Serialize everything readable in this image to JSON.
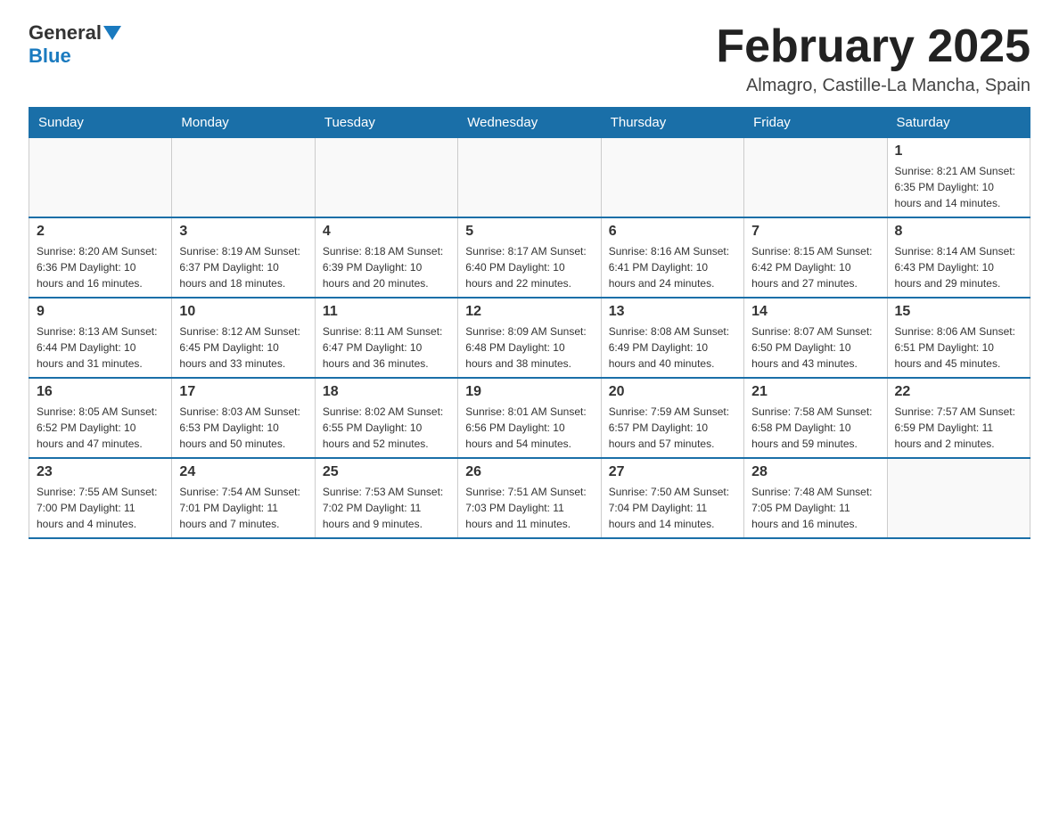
{
  "header": {
    "logo_general": "General",
    "logo_blue": "Blue",
    "title": "February 2025",
    "subtitle": "Almagro, Castille-La Mancha, Spain"
  },
  "weekdays": [
    "Sunday",
    "Monday",
    "Tuesday",
    "Wednesday",
    "Thursday",
    "Friday",
    "Saturday"
  ],
  "weeks": [
    [
      {
        "day": "",
        "info": ""
      },
      {
        "day": "",
        "info": ""
      },
      {
        "day": "",
        "info": ""
      },
      {
        "day": "",
        "info": ""
      },
      {
        "day": "",
        "info": ""
      },
      {
        "day": "",
        "info": ""
      },
      {
        "day": "1",
        "info": "Sunrise: 8:21 AM\nSunset: 6:35 PM\nDaylight: 10 hours and 14 minutes."
      }
    ],
    [
      {
        "day": "2",
        "info": "Sunrise: 8:20 AM\nSunset: 6:36 PM\nDaylight: 10 hours and 16 minutes."
      },
      {
        "day": "3",
        "info": "Sunrise: 8:19 AM\nSunset: 6:37 PM\nDaylight: 10 hours and 18 minutes."
      },
      {
        "day": "4",
        "info": "Sunrise: 8:18 AM\nSunset: 6:39 PM\nDaylight: 10 hours and 20 minutes."
      },
      {
        "day": "5",
        "info": "Sunrise: 8:17 AM\nSunset: 6:40 PM\nDaylight: 10 hours and 22 minutes."
      },
      {
        "day": "6",
        "info": "Sunrise: 8:16 AM\nSunset: 6:41 PM\nDaylight: 10 hours and 24 minutes."
      },
      {
        "day": "7",
        "info": "Sunrise: 8:15 AM\nSunset: 6:42 PM\nDaylight: 10 hours and 27 minutes."
      },
      {
        "day": "8",
        "info": "Sunrise: 8:14 AM\nSunset: 6:43 PM\nDaylight: 10 hours and 29 minutes."
      }
    ],
    [
      {
        "day": "9",
        "info": "Sunrise: 8:13 AM\nSunset: 6:44 PM\nDaylight: 10 hours and 31 minutes."
      },
      {
        "day": "10",
        "info": "Sunrise: 8:12 AM\nSunset: 6:45 PM\nDaylight: 10 hours and 33 minutes."
      },
      {
        "day": "11",
        "info": "Sunrise: 8:11 AM\nSunset: 6:47 PM\nDaylight: 10 hours and 36 minutes."
      },
      {
        "day": "12",
        "info": "Sunrise: 8:09 AM\nSunset: 6:48 PM\nDaylight: 10 hours and 38 minutes."
      },
      {
        "day": "13",
        "info": "Sunrise: 8:08 AM\nSunset: 6:49 PM\nDaylight: 10 hours and 40 minutes."
      },
      {
        "day": "14",
        "info": "Sunrise: 8:07 AM\nSunset: 6:50 PM\nDaylight: 10 hours and 43 minutes."
      },
      {
        "day": "15",
        "info": "Sunrise: 8:06 AM\nSunset: 6:51 PM\nDaylight: 10 hours and 45 minutes."
      }
    ],
    [
      {
        "day": "16",
        "info": "Sunrise: 8:05 AM\nSunset: 6:52 PM\nDaylight: 10 hours and 47 minutes."
      },
      {
        "day": "17",
        "info": "Sunrise: 8:03 AM\nSunset: 6:53 PM\nDaylight: 10 hours and 50 minutes."
      },
      {
        "day": "18",
        "info": "Sunrise: 8:02 AM\nSunset: 6:55 PM\nDaylight: 10 hours and 52 minutes."
      },
      {
        "day": "19",
        "info": "Sunrise: 8:01 AM\nSunset: 6:56 PM\nDaylight: 10 hours and 54 minutes."
      },
      {
        "day": "20",
        "info": "Sunrise: 7:59 AM\nSunset: 6:57 PM\nDaylight: 10 hours and 57 minutes."
      },
      {
        "day": "21",
        "info": "Sunrise: 7:58 AM\nSunset: 6:58 PM\nDaylight: 10 hours and 59 minutes."
      },
      {
        "day": "22",
        "info": "Sunrise: 7:57 AM\nSunset: 6:59 PM\nDaylight: 11 hours and 2 minutes."
      }
    ],
    [
      {
        "day": "23",
        "info": "Sunrise: 7:55 AM\nSunset: 7:00 PM\nDaylight: 11 hours and 4 minutes."
      },
      {
        "day": "24",
        "info": "Sunrise: 7:54 AM\nSunset: 7:01 PM\nDaylight: 11 hours and 7 minutes."
      },
      {
        "day": "25",
        "info": "Sunrise: 7:53 AM\nSunset: 7:02 PM\nDaylight: 11 hours and 9 minutes."
      },
      {
        "day": "26",
        "info": "Sunrise: 7:51 AM\nSunset: 7:03 PM\nDaylight: 11 hours and 11 minutes."
      },
      {
        "day": "27",
        "info": "Sunrise: 7:50 AM\nSunset: 7:04 PM\nDaylight: 11 hours and 14 minutes."
      },
      {
        "day": "28",
        "info": "Sunrise: 7:48 AM\nSunset: 7:05 PM\nDaylight: 11 hours and 16 minutes."
      },
      {
        "day": "",
        "info": ""
      }
    ]
  ]
}
